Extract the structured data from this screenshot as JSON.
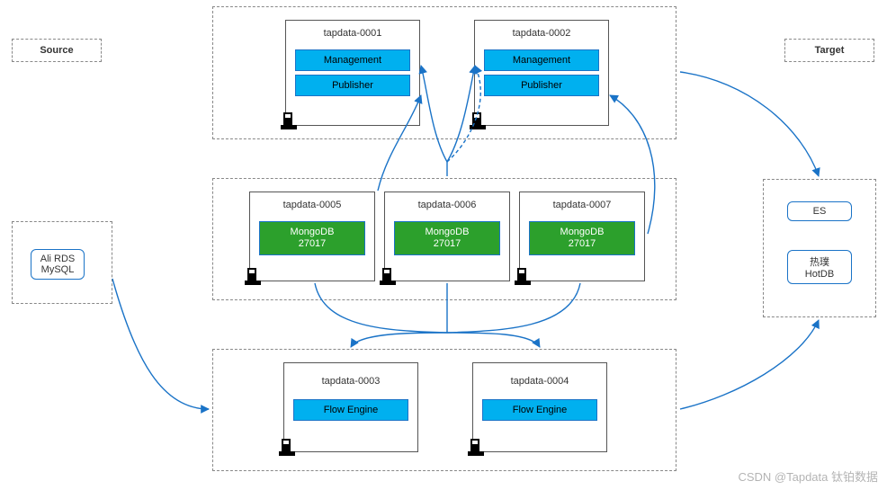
{
  "labels": {
    "source": "Source",
    "target": "Target"
  },
  "source": {
    "db": "Ali RDS\nMySQL"
  },
  "target": {
    "es": "ES",
    "hotdb": "热璞\nHotDB"
  },
  "top": {
    "nodes": [
      {
        "name": "tapdata-0001",
        "services": [
          "Management",
          "Publisher"
        ]
      },
      {
        "name": "tapdata-0002",
        "services": [
          "Management",
          "Publisher"
        ]
      }
    ]
  },
  "mid": {
    "nodes": [
      {
        "name": "tapdata-0005",
        "service": "MongoDB\n27017"
      },
      {
        "name": "tapdata-0006",
        "service": "MongoDB\n27017"
      },
      {
        "name": "tapdata-0007",
        "service": "MongoDB\n27017"
      }
    ]
  },
  "bottom": {
    "nodes": [
      {
        "name": "tapdata-0003",
        "service": "Flow Engine"
      },
      {
        "name": "tapdata-0004",
        "service": "Flow Engine"
      }
    ]
  },
  "watermark": "CSDN @Tapdata 钛铂数据"
}
